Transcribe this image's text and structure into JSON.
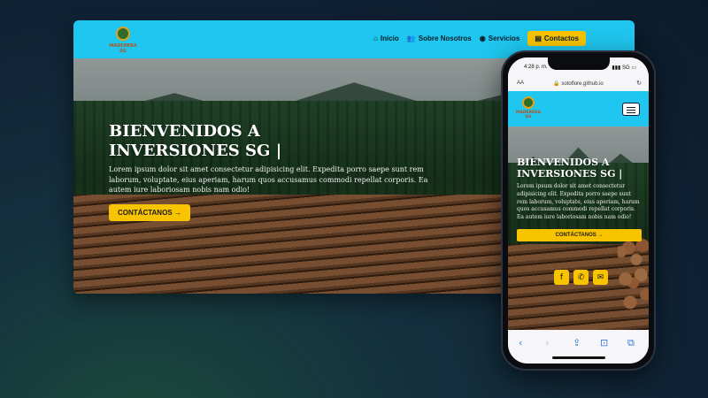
{
  "brand": {
    "logo_text": "MADERERA SG"
  },
  "desktop": {
    "nav": [
      {
        "icon": "home-icon",
        "glyph": "⌂",
        "label": "Inicio"
      },
      {
        "icon": "users-icon",
        "glyph": "👥",
        "label": "Sobre Nosotros"
      },
      {
        "icon": "user-circle-icon",
        "glyph": "◉",
        "label": "Servicios"
      },
      {
        "icon": "contact-card-icon",
        "glyph": "▤",
        "label": "Contactos"
      }
    ],
    "hero": {
      "title_line1": "BIENVENIDOS A",
      "title_line2": "INVERSIONES SG |",
      "text": "Lorem ipsum dolor sit amet consectetur adipisicing elit. Expedita porro saepe sunt rem laborum, voluptate, eius aperiam, harum quos accusamus commodi repellat corporis. Ea autem iure laboriosam nobis nam odio!",
      "button": "CONTÁCTANOS →"
    }
  },
  "phone": {
    "status": {
      "time": "4:28 p. m.",
      "right": "▮▮▮ SG ▭"
    },
    "url": {
      "aa": "AA",
      "address": "🔒 sotoflore.github.io",
      "reload": "↻"
    },
    "hero": {
      "title_line1": "BIENVENIDOS A",
      "title_line2": "INVERSIONES SG |",
      "text": "Lorem ipsum dolor sit amet consectetur adipisicing elit. Expedita porro saepe sunt rem laborum, voluptate, eius aperiam, harum quos accusamus commodi repellat corporis. Ea autem iure laboriosam nobis nam odio!",
      "button": "CONTÁCTANOS →"
    },
    "social": [
      {
        "icon": "facebook-icon",
        "glyph": "f"
      },
      {
        "icon": "whatsapp-icon",
        "glyph": "✆"
      },
      {
        "icon": "mail-icon",
        "glyph": "✉"
      }
    ],
    "toolbar": [
      {
        "icon": "back-icon",
        "glyph": "‹"
      },
      {
        "icon": "forward-icon",
        "glyph": "›"
      },
      {
        "icon": "share-icon",
        "glyph": "⇪"
      },
      {
        "icon": "bookmarks-icon",
        "glyph": "⊡"
      },
      {
        "icon": "tabs-icon",
        "glyph": "⧉"
      }
    ]
  },
  "colors": {
    "header": "#1fc6ef",
    "accent": "#f8c400",
    "background": "#0f2235"
  }
}
